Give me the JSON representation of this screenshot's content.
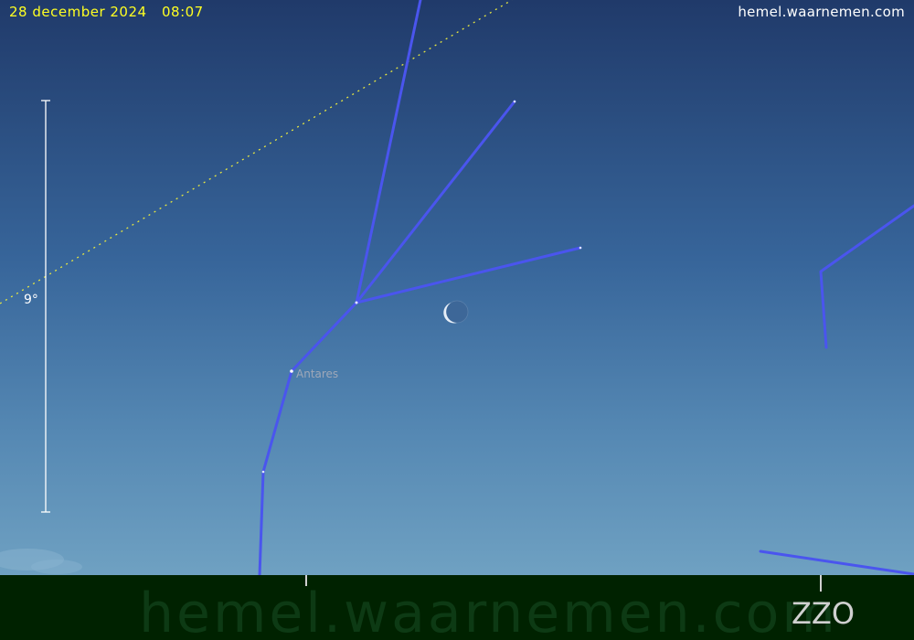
{
  "header": {
    "date": "28 december 2024",
    "time": "08:07",
    "site": "hemel.waarnemen.com"
  },
  "scale": {
    "label": "9°"
  },
  "stars": [
    {
      "label": "Antares"
    }
  ],
  "ground": {
    "watermark": "hemel.waarnemen.com",
    "compass_direction": "ZZO"
  },
  "colors": {
    "sky_top": "#203a6a",
    "sky_bottom": "#6d9ec0",
    "ground": "#002200",
    "constellation_line": "#4a55ee",
    "ecliptic": "#e8e840",
    "header_text": "#ffff22",
    "watermark": "#0d3a14",
    "compass_text": "#d0d0d0"
  },
  "icons": [
    "moon-crescent-icon",
    "star-dot-icon"
  ]
}
